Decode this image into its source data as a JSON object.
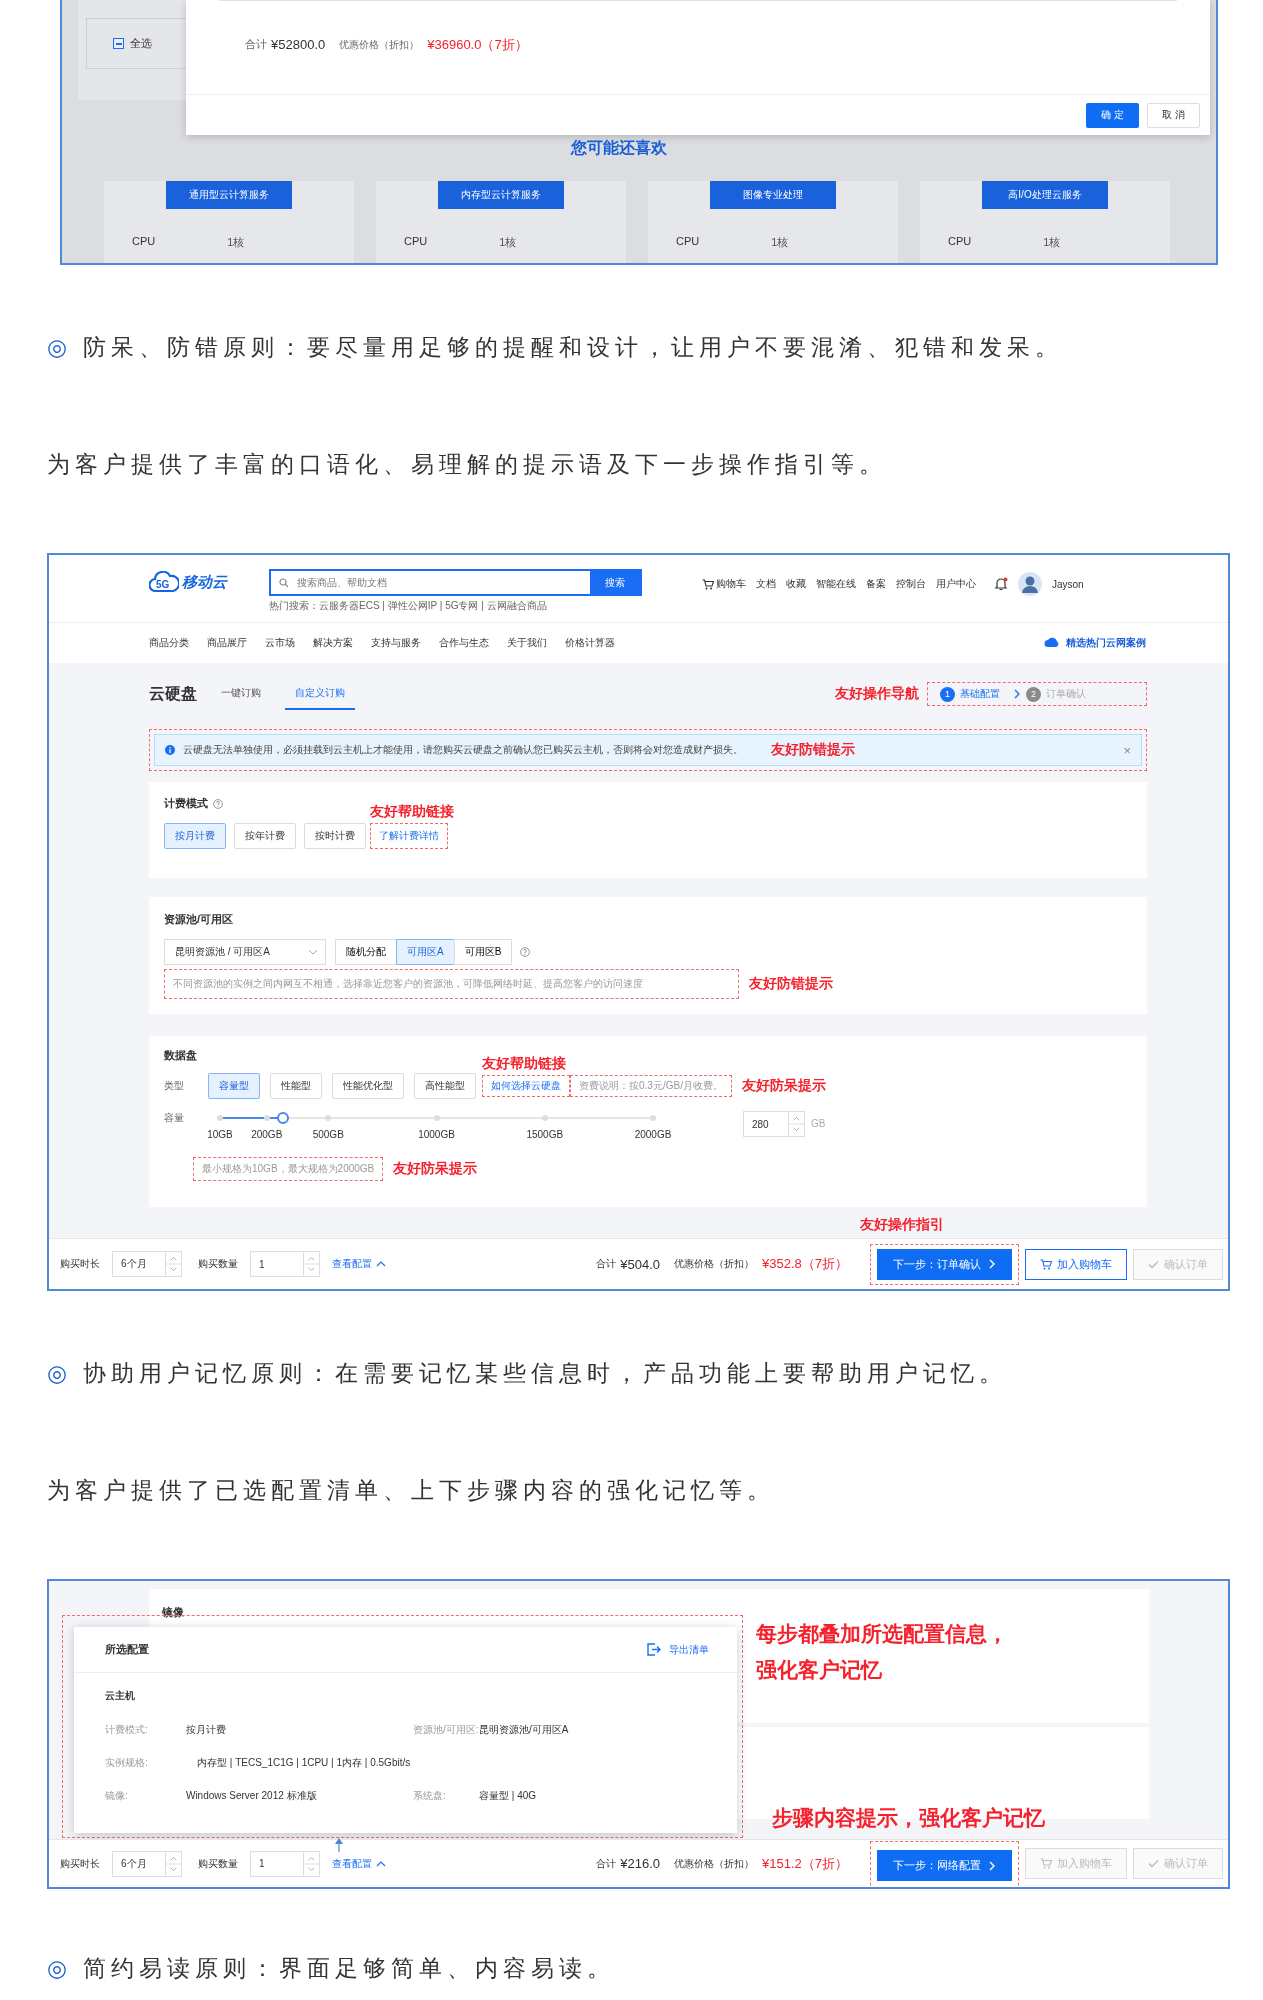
{
  "top_screenshot": {
    "select_all": {
      "label": "全选",
      "indeterminate": true
    },
    "modal": {
      "total_label": "合计",
      "total": "¥52800.0",
      "discount_label": "优惠价格（折扣）",
      "discount": "¥36960.0（7折）",
      "buttons": [
        {
          "label": "确 定",
          "primary": true
        },
        {
          "label": "取 消",
          "primary": false
        }
      ]
    },
    "recommend": {
      "title": "您可能还喜欢",
      "cards": [
        {
          "name": "通用型云计算服务",
          "spec_label": "CPU",
          "spec_value": "1核"
        },
        {
          "name": "内存型云计算服务",
          "spec_label": "CPU",
          "spec_value": "1核"
        },
        {
          "name": "图像专业处理",
          "spec_label": "CPU",
          "spec_value": "1核"
        },
        {
          "name": "高I/O处理云服务",
          "spec_label": "CPU",
          "spec_value": "1核"
        }
      ]
    }
  },
  "principle_1": {
    "marker": "◎",
    "text": "防呆、防错原则：要尽量用足够的提醒和设计，让用户不要混淆、犯错和发呆。"
  },
  "paragraph_1": "为客户提供了丰富的口语化、易理解的提示语及下一步操作指引等。",
  "order_screenshot": {
    "header": {
      "logo_badge": "5G",
      "logo": "移动云",
      "search_placeholder": "搜索商品、帮助文档",
      "search_button": "搜索",
      "hot_search": "热门搜索：云服务器ECS | 弹性公网IP | 5G专网 | 云网融合商品",
      "links": [
        "购物车",
        "文档",
        "收藏",
        "智能在线",
        "备案",
        "控制台",
        "用户中心"
      ],
      "notification_dot": true,
      "user": "Jayson"
    },
    "nav": [
      "商品分类",
      "商品展厅",
      "云市场",
      "解决方案",
      "支持与服务",
      "合作与生态",
      "关于我们",
      "价格计算器"
    ],
    "nav_promo": "精选热门云网案例",
    "title": "云硬盘",
    "tabs": [
      {
        "label": "一键订购",
        "selected": false
      },
      {
        "label": "自定义订购",
        "selected": true
      }
    ],
    "nav_annotation": "友好操作导航",
    "steps": [
      {
        "number": "1",
        "label": "基础配置",
        "active": true
      },
      {
        "number": "2",
        "label": "订单确认",
        "active": false
      }
    ],
    "notice": {
      "text": "云硬盘无法单独使用，必须挂载到云主机上才能使用，请您购买云硬盘之前确认您已购买云主机，否则将会对您造成财产损失。",
      "close": "×",
      "annotation": "友好防错提示"
    },
    "billing": {
      "title": "计费模式",
      "options": [
        {
          "label": "按月计费",
          "selected": true
        },
        {
          "label": "按年计费",
          "selected": false
        },
        {
          "label": "按时计费",
          "selected": false
        }
      ],
      "help_link": "了解计费详情",
      "annotation": "友好帮助链接"
    },
    "zone": {
      "title": "资源池/可用区",
      "pool": "昆明资源池 / 可用区A",
      "options": [
        {
          "label": "随机分配",
          "selected": false
        },
        {
          "label": "可用区A",
          "selected": true
        },
        {
          "label": "可用区B",
          "selected": false
        }
      ],
      "hint": "不同资源池的实例之间内网互不相通，选择靠近您客户的资源池，可降低网络时延、提高您客户的访问速度",
      "annotation": "友好防错提示"
    },
    "disk": {
      "title": "数据盘",
      "type_label": "类型",
      "types": [
        {
          "label": "容量型",
          "selected": true
        },
        {
          "label": "性能型",
          "selected": false
        },
        {
          "label": "性能优化型",
          "selected": false
        },
        {
          "label": "高性能型",
          "selected": false
        }
      ],
      "help_link": "如何选择云硬盘",
      "link_annotation": "友好帮助链接",
      "fee_hint": "资费说明：按0.3元/GB/月收费。",
      "fee_annotation": "友好防呆提示",
      "capacity_label": "容量",
      "level": 0.145,
      "ticks": [
        "10GB",
        "200GB",
        "500GB",
        "1000GB",
        "1500GB",
        "2000GB"
      ],
      "capacity": "280",
      "unit": "GB",
      "range_hint": "最小规格为10GB，最大规格为2000GB",
      "range_annotation": "友好防呆提示"
    },
    "footer_annotation": "友好操作指引",
    "footer": {
      "duration_label": "购买时长",
      "duration": "6个月",
      "quantity_label": "购买数量",
      "quantity": "1",
      "view_config": "查看配置",
      "total_label": "合计",
      "total": "¥504.0",
      "discount_label": "优惠价格（折扣）",
      "discount": "¥352.8（7折）",
      "next": "下一步：订单确认",
      "cart": {
        "label": "加入购物车",
        "disabled": false
      },
      "confirm": {
        "label": "确认订单",
        "disabled": true
      }
    }
  },
  "principle_2": {
    "marker": "◎",
    "text": "协助用户记忆原则：在需要记忆某些信息时，产品功能上要帮助用户记忆。"
  },
  "paragraph_2": "为客户提供了已选配置清单、上下步骤内容的强化记忆等。",
  "config_screenshot": {
    "panel_title": "镜像",
    "popup": {
      "title": "所选配置",
      "export": "导出清单",
      "group": "云主机",
      "rows": [
        {
          "label": "计费模式:",
          "value": "按月计费",
          "label_2": "资源池/可用区:",
          "value_2": "昆明资源池/可用区A"
        },
        {
          "label": "实例规格:",
          "value": "内存型 | TECS_1C1G | 1CPU | 1内存 | 0.5Gbit/s"
        },
        {
          "label": "镜像:",
          "value": "Windows Server 2012 标准版",
          "label_2": "系统盘:",
          "value_2": "容量型 | 40G"
        }
      ]
    },
    "annotation_lines": [
      "每步都叠加所选配置信息，",
      "强化客户记忆"
    ],
    "footer_annotation": "步骤内容提示，强化客户记忆",
    "footer": {
      "duration_label": "购买时长",
      "duration": "6个月",
      "quantity_label": "购买数量",
      "quantity": "1",
      "view_config": "查看配置",
      "total_label": "合计",
      "total": "¥216.0",
      "discount_label": "优惠价格（折扣）",
      "discount": "¥151.2（7折）",
      "next": "下一步：网络配置",
      "cart": {
        "label": "加入购物车",
        "disabled": true
      },
      "confirm": {
        "label": "确认订单",
        "disabled": true
      }
    }
  },
  "principle_3": {
    "marker": "◎",
    "text": "简约易读原则：界面足够简单、内容易读。"
  }
}
